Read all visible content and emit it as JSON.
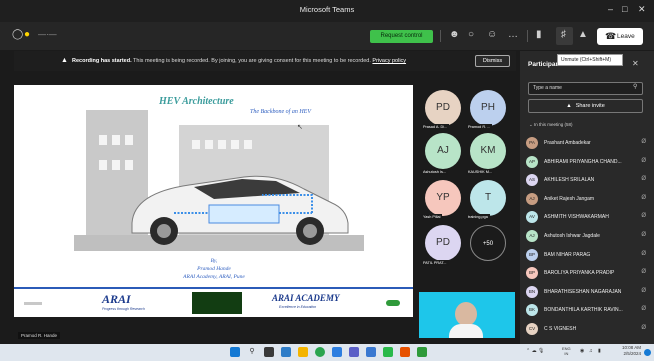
{
  "window": {
    "title": "Microsoft Teams"
  },
  "toolbar": {
    "request_control_label": "Request control",
    "leave_label": "Leave",
    "more_label": "…"
  },
  "tooltip": {
    "text": "Unmute (Ctrl+Shift+M)"
  },
  "banner": {
    "strong": "Recording has started.",
    "message": " This meeting is being recorded. By joining, you are giving consent for this meeting to be recorded. ",
    "link": "Privacy policy",
    "dismiss_label": "Dismiss"
  },
  "slide": {
    "title": "HEV Architecture",
    "subtitle": "The Backbone of an HEV",
    "author_by": "By,",
    "author_name": "Pramod Hande",
    "author_org": "ARAI Academy, ARAI, Pune",
    "logo_arai": "ARAI",
    "logo_arai_sub": "Progress through Research",
    "logo_academy": "ARAI ACADEMY",
    "logo_academy_sub": "Excellence in Education"
  },
  "presenter_label": "Pramod R. Hande",
  "tiles": [
    {
      "initials": "PD",
      "name": "Prasad A. Di...",
      "color": "#e7d3c3"
    },
    {
      "initials": "PH",
      "name": "Pramod R. ...",
      "color": "#bcd0ee"
    },
    {
      "initials": "AJ",
      "name": "Ashutosh Is...",
      "color": "#b8e4c8"
    },
    {
      "initials": "KM",
      "name": "KAUSHIK M...",
      "color": "#b8e4c8"
    },
    {
      "initials": "YP",
      "name": "Yash Pillai",
      "color": "#f6c7bd"
    },
    {
      "initials": "T",
      "name": "training.pga",
      "color": "#bde6ea"
    },
    {
      "initials": "PD",
      "name": "PATIL PRAT...",
      "color": "#dcd6f1"
    }
  ],
  "overflow_tile": "+50",
  "panel": {
    "title": "Participants",
    "search_placeholder": "Type a name",
    "share_invite_label": "Share invite",
    "section_label": "In this meeting (58)",
    "participants": [
      {
        "name": "Prashant Ambadekar",
        "initials": "PA",
        "color": "#c79d82"
      },
      {
        "name": "ABHIRAMI PRIYANGHA CHAND...",
        "initials": "AP",
        "color": "#b8e4c8"
      },
      {
        "name": "AKHILESH SRILALAN",
        "initials": "AS",
        "color": "#dcd6f1"
      },
      {
        "name": "Aniket Rajesh Jangam",
        "initials": "AJ",
        "color": "#c79d82"
      },
      {
        "name": "ASHMITH VISHWAKARMAH",
        "initials": "AV",
        "color": "#bde6ea"
      },
      {
        "name": "Ashutosh Ishwar Jagdale",
        "initials": "AJ",
        "color": "#b8e4c8"
      },
      {
        "name": "BAM NIHAR PARAG",
        "initials": "BP",
        "color": "#bcd0ee"
      },
      {
        "name": "BAROLIYA PRIYANKA PRADIP",
        "initials": "BP",
        "color": "#f6c7bd"
      },
      {
        "name": "BHARATHISESHAN NAGARAJAN",
        "initials": "BN",
        "color": "#dcd6f1"
      },
      {
        "name": "BONDANTHILA KARTHIK RAVIN...",
        "initials": "BK",
        "color": "#bde6ea"
      },
      {
        "name": "C S VIGNESH",
        "initials": "CV",
        "color": "#e7d3c3"
      }
    ]
  },
  "taskbar": {
    "lang": "ENG",
    "lang2": "IN",
    "time": "10:08 AM",
    "date": "2/5/2024"
  }
}
